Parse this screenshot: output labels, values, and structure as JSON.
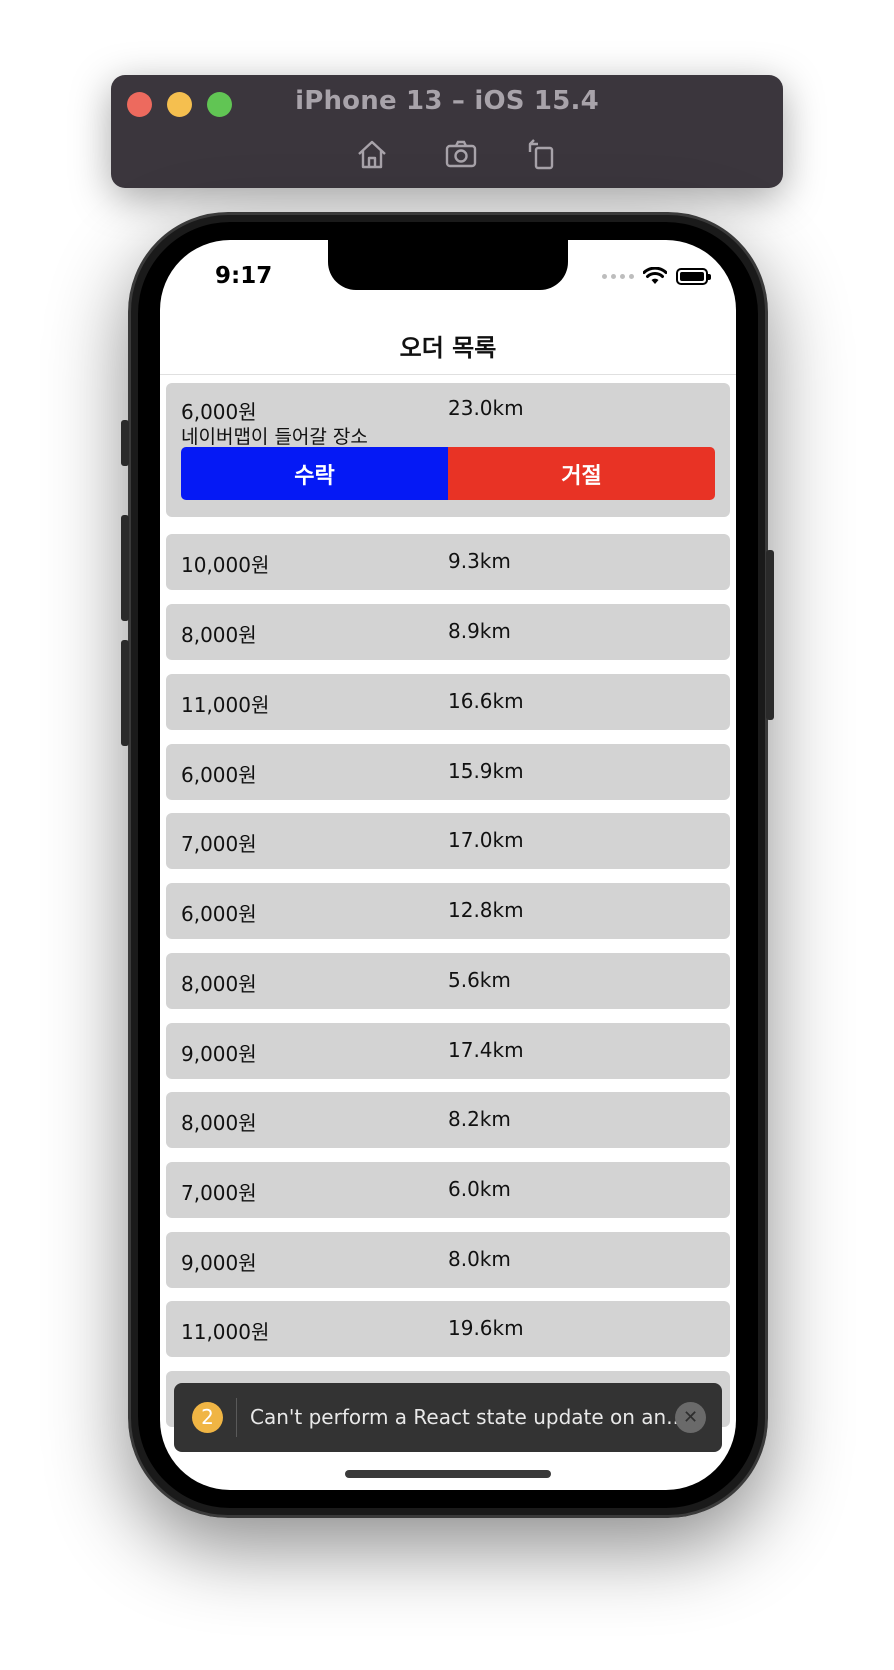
{
  "simulator": {
    "title": "iPhone 13 – iOS 15.4",
    "toolbar_icons": [
      "home-icon",
      "screenshot-icon",
      "rotate-icon"
    ]
  },
  "status_bar": {
    "time": "9:17"
  },
  "nav": {
    "title": "오더 목록"
  },
  "orders": [
    {
      "price": "6,000원",
      "distance": "23.0km",
      "place": "네이버맵이 들어갈 장소",
      "accept_label": "수락",
      "reject_label": "거절"
    },
    {
      "price": "10,000원",
      "distance": "9.3km"
    },
    {
      "price": "8,000원",
      "distance": "8.9km"
    },
    {
      "price": "11,000원",
      "distance": "16.6km"
    },
    {
      "price": "6,000원",
      "distance": "15.9km"
    },
    {
      "price": "7,000원",
      "distance": "17.0km"
    },
    {
      "price": "6,000원",
      "distance": "12.8km"
    },
    {
      "price": "8,000원",
      "distance": "5.6km"
    },
    {
      "price": "9,000원",
      "distance": "17.4km"
    },
    {
      "price": "8,000원",
      "distance": "8.2km"
    },
    {
      "price": "7,000원",
      "distance": "6.0km"
    },
    {
      "price": "9,000원",
      "distance": "8.0km"
    },
    {
      "price": "11,000원",
      "distance": "19.6km"
    }
  ],
  "toast": {
    "count": "2",
    "message": "Can't perform a React state update on an..."
  },
  "colors": {
    "accept": "#0519f5",
    "reject": "#e83325",
    "card": "#d3d3d3"
  }
}
